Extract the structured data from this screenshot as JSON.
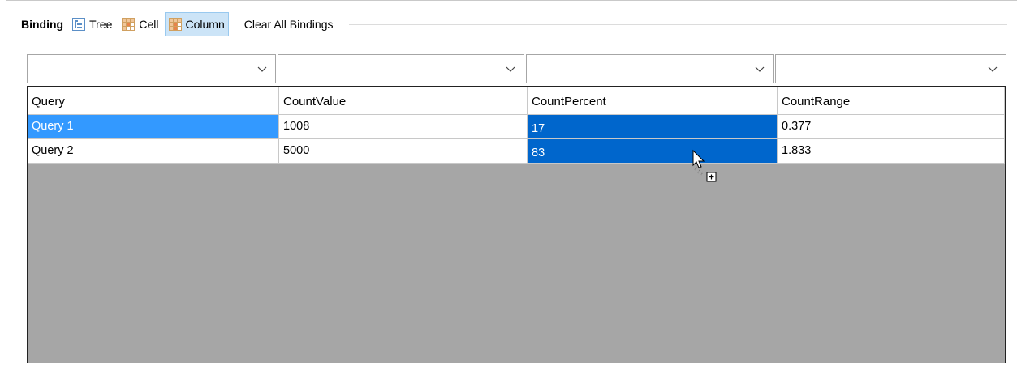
{
  "toolbar": {
    "title": "Binding",
    "buttons": [
      {
        "label": "Tree",
        "icon": "tree-icon",
        "active": false
      },
      {
        "label": "Cell",
        "icon": "cell-grid-icon",
        "active": false
      },
      {
        "label": "Column",
        "icon": "column-grid-icon",
        "active": true
      }
    ],
    "clear_label": "Clear All Bindings"
  },
  "combos": [
    {
      "value": "",
      "icon": "chevron-down-icon"
    },
    {
      "value": "",
      "icon": "chevron-down-icon"
    },
    {
      "value": "",
      "icon": "chevron-down-icon"
    },
    {
      "value": "",
      "icon": "chevron-down-icon"
    }
  ],
  "grid": {
    "columns": [
      "Query",
      "CountValue",
      "CountPercent",
      "CountRange"
    ],
    "rows": [
      [
        "Query 1",
        "1008",
        "17",
        "0.377"
      ],
      [
        "Query 2",
        "5000",
        "83",
        "1.833"
      ]
    ],
    "selected_row": 0,
    "selected_column": 2
  },
  "colors": {
    "row_selection": "#3399ff",
    "column_selection": "#0066cc",
    "active_button": "#cce4f7",
    "empty_area": "#a6a6a6"
  },
  "cursor": {
    "icon": "drag-copy-cursor-icon"
  }
}
